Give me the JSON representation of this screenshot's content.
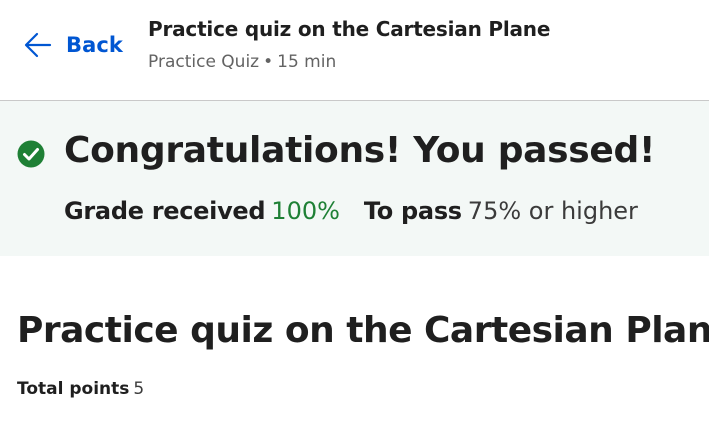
{
  "header": {
    "back_label": "Back",
    "title": "Practice quiz on the Cartesian Plane",
    "meta_type": "Practice Quiz",
    "meta_separator": "•",
    "meta_duration": "15 min"
  },
  "result": {
    "title": "Congratulations! You passed!",
    "grade_label": "Grade received",
    "grade_value": "100%",
    "pass_label": "To pass",
    "pass_value": "75% or higher",
    "status_icon": "check-circle-icon",
    "accent_color": "#1e8035"
  },
  "main": {
    "title": "Practice quiz on the Cartesian Plane",
    "points_label": "Total points",
    "points_value": "5"
  },
  "colors": {
    "link": "#0056d2",
    "banner_bg": "#f3f8f6",
    "success": "#1e8035"
  }
}
